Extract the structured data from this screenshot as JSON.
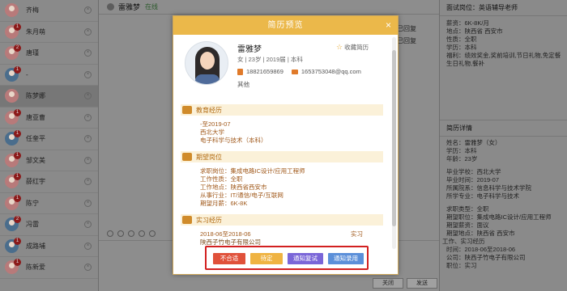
{
  "contacts": [
    {
      "name": "齐梅",
      "badge": "",
      "gender": "girl",
      "selected": false
    },
    {
      "name": "朱月萌",
      "badge": "1",
      "gender": "girl",
      "selected": false
    },
    {
      "name": "唐瑾",
      "badge": "2",
      "gender": "girl",
      "selected": false
    },
    {
      "name": "-",
      "badge": "1",
      "gender": "boy",
      "selected": false
    },
    {
      "name": "陈梦娜",
      "badge": "",
      "gender": "girl",
      "selected": true
    },
    {
      "name": "唐亚曹",
      "badge": "1",
      "gender": "girl",
      "selected": false
    },
    {
      "name": "任奎平",
      "badge": "1",
      "gender": "boy",
      "selected": false
    },
    {
      "name": "邹文美",
      "badge": "1",
      "gender": "girl",
      "selected": false
    },
    {
      "name": "薛红宇",
      "badge": "1",
      "gender": "girl",
      "selected": false
    },
    {
      "name": "陈宁",
      "badge": "1",
      "gender": "girl",
      "selected": false
    },
    {
      "name": "冯雷",
      "badge": "2",
      "gender": "boy",
      "selected": false
    },
    {
      "name": "成路埔",
      "badge": "1",
      "gender": "boy",
      "selected": false
    },
    {
      "name": "陈新爱",
      "badge": "1",
      "gender": "girl",
      "selected": false
    }
  ],
  "chat": {
    "name": "雷雅梦",
    "status": "在线",
    "side_notes": [
      "该简历已回复",
      "该简历已回复"
    ],
    "close_label": "关闭",
    "send_label": "发送"
  },
  "right_panel": {
    "job_title": "面试岗位：英语辅导老师",
    "job_lines": [
      "薪资：6K-8K/月",
      "地点：陕西省 西安市",
      "性质：全职",
      "学历：本科",
      "福利：绩效奖金,奖前培训,节日礼物,免定餐",
      "生日礼物,餐补"
    ],
    "resume_title": "简历详情",
    "resume_lines": [
      "姓名：雷雅梦（女）",
      "学历：本科",
      "年龄：23岁",
      "",
      "毕业学校：西北大学",
      "毕业时间：2019-07",
      "所属院系：信息科学与技术学院",
      "所学专业：电子科学与技术",
      "",
      "求职类型：全职",
      "期望职位：集成电路IC设计/应用工程师",
      "期望薪资：面议",
      "期望地点：陕西省 西安市"
    ],
    "exp_title": "工作、实习经历",
    "exp_lines": [
      "时间：2018-06至2018-06",
      "公司：陕西子竹电子有限公司",
      "职位：实习"
    ]
  },
  "modal": {
    "title": "简历预览",
    "close_icon": "×",
    "profile": {
      "name": "雷雅梦",
      "info": "女 | 23岁 | 2019届 | 本科",
      "phone": "18821659869",
      "email": "1653753048@qq.com",
      "other": "其他",
      "favorite_label": "收藏简历"
    },
    "education": {
      "title": "教育经历",
      "lines": [
        "-至2019-07",
        "西北大学",
        "电子科学与技术（本科）"
      ]
    },
    "expectation": {
      "title": "期望岗位",
      "lines": [
        "求职岗位：集成电路IC设计/应用工程师",
        "工作性质：全职",
        "工作地点：陕西省西安市",
        "从事行业：IT/通信/电子/互联网",
        "期望月薪：6K-8K"
      ]
    },
    "internship": {
      "title": "实习经历",
      "period": "2018-06至2018-06",
      "tag": "实习",
      "company": "陕西子竹电子有限公司"
    },
    "actions": [
      {
        "label": "不合适",
        "color": "#e0513a"
      },
      {
        "label": "待定",
        "color": "#efb342"
      },
      {
        "label": "通知复试",
        "color": "#7a66d8"
      },
      {
        "label": "通知录用",
        "color": "#5b8fd9"
      }
    ]
  }
}
